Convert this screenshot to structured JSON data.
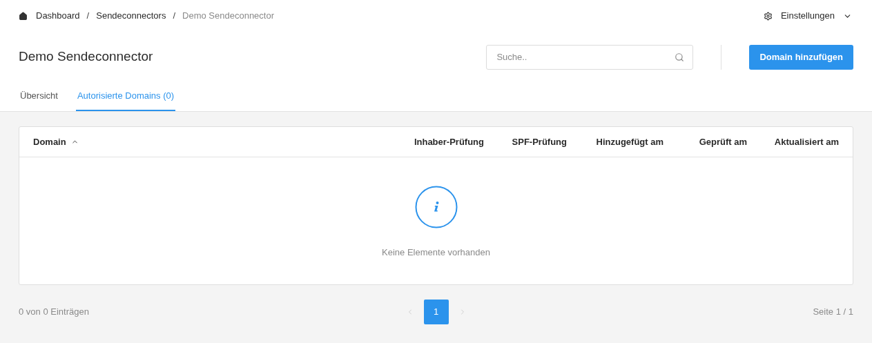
{
  "breadcrumb": [
    {
      "label": "Dashboard",
      "current": false
    },
    {
      "label": "Sendeconnectors",
      "current": false
    },
    {
      "label": "Demo Sendeconnector",
      "current": true
    }
  ],
  "breadcrumb_separators": [
    "/",
    "/"
  ],
  "settings_menu": {
    "label": "Einstellungen"
  },
  "page_title": "Demo Sendeconnector",
  "search": {
    "placeholder": "Suche.."
  },
  "add_button": "Domain hinzufügen",
  "tabs": [
    {
      "label": "Übersicht",
      "selected": false
    },
    {
      "label": "Autorisierte Domains (0)",
      "selected": true
    }
  ],
  "table": {
    "columns": [
      {
        "label": "Domain",
        "sorted": true
      },
      {
        "label": "Inhaber-Prüfung",
        "sorted": false
      },
      {
        "label": "SPF-Prüfung",
        "sorted": false
      },
      {
        "label": "Hinzugefügt am",
        "sorted": false
      },
      {
        "label": "Geprüft am",
        "sorted": false
      },
      {
        "label": "Aktualisiert am",
        "sorted": false
      }
    ],
    "empty_message": "Keine Elemente vorhanden"
  },
  "footer": {
    "count": "0 von 0 Einträgen",
    "pages": [
      {
        "label": "1",
        "selected": true
      }
    ],
    "prev_disabled": true,
    "next_disabled": true,
    "page_info": "Seite 1 / 1"
  }
}
